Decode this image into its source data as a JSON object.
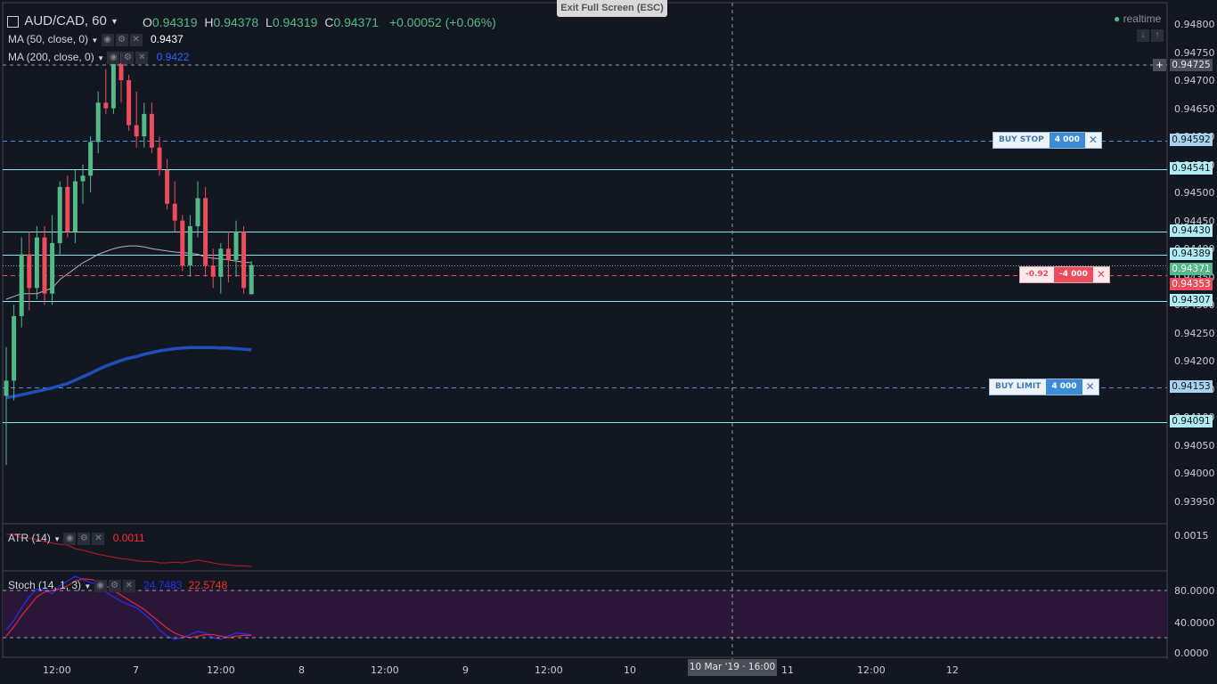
{
  "exit_fullscreen": "Exit Full Screen (ESC)",
  "header": {
    "symbol": "AUD/CAD, 60",
    "o_label": "O",
    "o_value": "0.94319",
    "h_label": "H",
    "h_value": "0.94378",
    "l_label": "L",
    "l_value": "0.94319",
    "c_label": "C",
    "c_value": "0.94371",
    "change": "+0.00052 (+0.06%)",
    "realtime": "realtime"
  },
  "indicators": {
    "ma50_label": "MA (50, close, 0)",
    "ma50_value": "0.9437",
    "ma200_label": "MA (200, close, 0)",
    "ma200_value": "0.9422",
    "atr_label": "ATR (14)",
    "atr_value": "0.0011",
    "stoch_label": "Stoch (14, 1, 3)",
    "stoch_k": "24.7483",
    "stoch_d": "22.5748"
  },
  "price_axis": {
    "labels": [
      "0.94800",
      "0.94750",
      "0.94700",
      "0.94650",
      "0.94600",
      "0.94550",
      "0.94500",
      "0.94450",
      "0.94400",
      "0.94350",
      "0.94300",
      "0.94250",
      "0.94200",
      "0.94150",
      "0.94100",
      "0.94050",
      "0.94000",
      "0.93950"
    ],
    "atr_label": "0.0015",
    "stoch_labels": [
      "80.0000",
      "40.0000",
      "0.0000"
    ]
  },
  "price_boxes": [
    {
      "text": "0.94725",
      "color": "#4a4e59",
      "fg": "#e6e6e6"
    },
    {
      "text": "0.94592",
      "color": "#a7d3ef",
      "fg": "#0b1a20"
    },
    {
      "text": "0.94541",
      "color": "#b2ebf2",
      "fg": "#0b1a20"
    },
    {
      "text": "0.94430",
      "color": "#b2ebf2",
      "fg": "#0b1a20"
    },
    {
      "text": "0.94389",
      "color": "#b2ebf2",
      "fg": "#0b1a20"
    },
    {
      "text": "0.94371",
      "color": "#53b987",
      "fg": "#ffffff"
    },
    {
      "text": "0.94353",
      "color": "#eb4d5c",
      "fg": "#ffffff"
    },
    {
      "text": "0.94307",
      "color": "#b2ebf2",
      "fg": "#0b1a20"
    },
    {
      "text": "0.94153",
      "color": "#a7d3ef",
      "fg": "#0b1a20"
    },
    {
      "text": "0.94091",
      "color": "#b2ebf2",
      "fg": "#0b1a20"
    }
  ],
  "orders": {
    "buy_stop": {
      "type": "BUY STOP",
      "qty": "4 000",
      "close": "✕"
    },
    "position": {
      "pnl": "-0.92",
      "qty": "-4 000",
      "close": "✕"
    },
    "buy_limit": {
      "type": "BUY LIMIT",
      "qty": "4 000",
      "close": "✕"
    }
  },
  "time_axis": {
    "labels": [
      "12:00",
      "7",
      "12:00",
      "8",
      "12:00",
      "9",
      "12:00",
      "10",
      "11",
      "12:00",
      "12"
    ],
    "crosshair": "10 Mar '19 · 16:00"
  },
  "chart_data": {
    "type": "candlestick",
    "symbol": "AUD/CAD",
    "interval": "60",
    "y_range": [
      0.9393,
      0.9481
    ],
    "candles": [
      [
        0.94138,
        0.94225,
        0.94015,
        0.94165
      ],
      [
        0.94165,
        0.943,
        0.9413,
        0.9428
      ],
      [
        0.9428,
        0.9442,
        0.9426,
        0.9439
      ],
      [
        0.9439,
        0.9443,
        0.9429,
        0.9433
      ],
      [
        0.9433,
        0.9444,
        0.9431,
        0.9442
      ],
      [
        0.9442,
        0.9444,
        0.943,
        0.9432
      ],
      [
        0.9432,
        0.9446,
        0.943,
        0.9441
      ],
      [
        0.9441,
        0.9452,
        0.9439,
        0.9451
      ],
      [
        0.9451,
        0.9453,
        0.9442,
        0.9443
      ],
      [
        0.9443,
        0.9454,
        0.9441,
        0.9452
      ],
      [
        0.9452,
        0.9455,
        0.9448,
        0.9453
      ],
      [
        0.9453,
        0.946,
        0.945,
        0.9459
      ],
      [
        0.9459,
        0.9468,
        0.9457,
        0.9466
      ],
      [
        0.9466,
        0.9472,
        0.9464,
        0.9465
      ],
      [
        0.9465,
        0.94745,
        0.9464,
        0.9473
      ],
      [
        0.9473,
        0.9475,
        0.9466,
        0.947
      ],
      [
        0.947,
        0.9471,
        0.9461,
        0.9462
      ],
      [
        0.9462,
        0.9468,
        0.9458,
        0.946
      ],
      [
        0.946,
        0.9466,
        0.9458,
        0.9464
      ],
      [
        0.9464,
        0.9466,
        0.9457,
        0.9458
      ],
      [
        0.9458,
        0.946,
        0.9453,
        0.9454
      ],
      [
        0.9454,
        0.9456,
        0.9447,
        0.9448
      ],
      [
        0.9448,
        0.9452,
        0.9443,
        0.9445
      ],
      [
        0.9445,
        0.9446,
        0.9436,
        0.9437
      ],
      [
        0.9437,
        0.9446,
        0.9435,
        0.9444
      ],
      [
        0.9444,
        0.9452,
        0.9442,
        0.9449
      ],
      [
        0.9449,
        0.9451,
        0.9435,
        0.9437
      ],
      [
        0.9437,
        0.944,
        0.9433,
        0.9435
      ],
      [
        0.9435,
        0.9441,
        0.9432,
        0.944
      ],
      [
        0.944,
        0.9443,
        0.9434,
        0.9438
      ],
      [
        0.9438,
        0.9445,
        0.9435,
        0.9443
      ],
      [
        0.9443,
        0.9444,
        0.9432,
        0.9433
      ],
      [
        0.94319,
        0.94378,
        0.94319,
        0.94371
      ]
    ],
    "ma50": [
      0.9431,
      0.94315,
      0.9432,
      0.9432,
      0.9432,
      0.94325,
      0.9433,
      0.94345,
      0.94355,
      0.94365,
      0.94375,
      0.94382,
      0.9439,
      0.94395,
      0.944,
      0.94403,
      0.94405,
      0.94405,
      0.94403,
      0.944,
      0.94398,
      0.94396,
      0.94394,
      0.94393,
      0.94392,
      0.9439,
      0.94385,
      0.94383,
      0.94382,
      0.9438,
      0.94378,
      0.94376,
      0.94375
    ],
    "ma200": [
      0.94135,
      0.94137,
      0.9414,
      0.94143,
      0.94146,
      0.94149,
      0.94152,
      0.94156,
      0.9416,
      0.94166,
      0.94172,
      0.94178,
      0.94185,
      0.94191,
      0.94196,
      0.94201,
      0.94205,
      0.94208,
      0.94212,
      0.94215,
      0.94218,
      0.9422,
      0.94222,
      0.94223,
      0.94224,
      0.94224,
      0.94224,
      0.94224,
      0.94223,
      0.94223,
      0.94222,
      0.94221,
      0.9422
    ],
    "atr": [
      0.0015,
      0.0015,
      0.00145,
      0.00145,
      0.00143,
      0.0014,
      0.00138,
      0.00136,
      0.00135,
      0.0013,
      0.00128,
      0.00125,
      0.00122,
      0.0012,
      0.00118,
      0.00116,
      0.00115,
      0.00113,
      0.00112,
      0.00112,
      0.0011,
      0.0011,
      0.00111,
      0.0011,
      0.00112,
      0.00114,
      0.00112,
      0.0011,
      0.00108,
      0.00107,
      0.00106,
      0.00106,
      0.00105
    ],
    "stoch_k": [
      30,
      42,
      58,
      72,
      82,
      80,
      76,
      86,
      92,
      98,
      94,
      90,
      88,
      78,
      72,
      66,
      62,
      58,
      50,
      42,
      30,
      22,
      18,
      20,
      24,
      28,
      26,
      20,
      18,
      22,
      26,
      25,
      24
    ],
    "stoch_d": [
      22,
      34,
      48,
      60,
      72,
      78,
      80,
      82,
      86,
      92,
      95,
      94,
      92,
      86,
      80,
      74,
      68,
      62,
      56,
      48,
      40,
      32,
      26,
      22,
      20,
      22,
      24,
      24,
      22,
      20,
      22,
      23,
      23
    ],
    "horizontal_lines": [
      0.94725,
      0.94592,
      0.94541,
      0.9443,
      0.94389,
      0.94353,
      0.94307,
      0.94153,
      0.94091
    ]
  }
}
